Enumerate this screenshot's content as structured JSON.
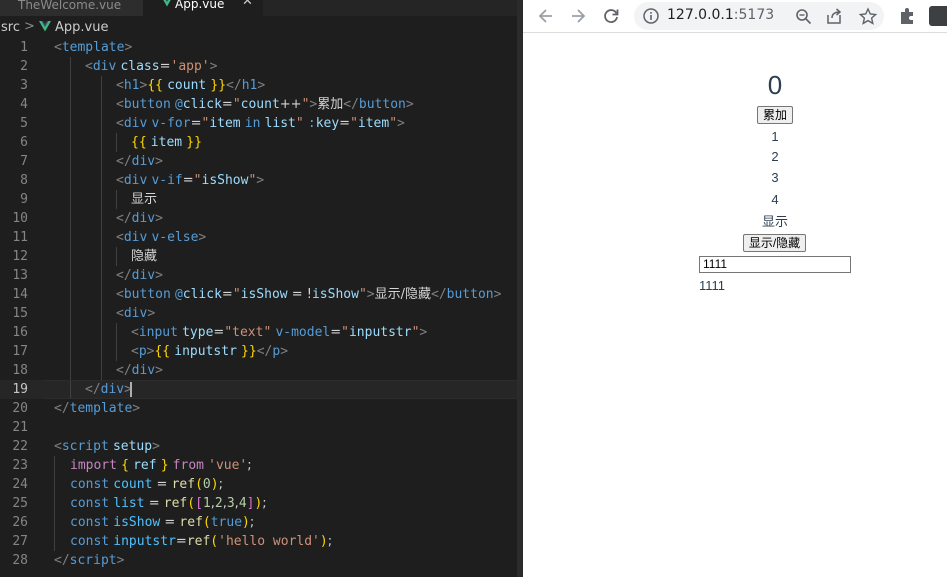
{
  "editor": {
    "tabs": [
      {
        "label": "TheWelcome.vue"
      },
      {
        "label": "App.vue",
        "close": "✕"
      }
    ],
    "breadcrumb": {
      "folder": "src",
      "separator": ">",
      "file": "App.vue"
    },
    "line_numbers": [
      "1",
      "2",
      "3",
      "4",
      "5",
      "6",
      "7",
      "8",
      "9",
      "10",
      "11",
      "12",
      "13",
      "14",
      "15",
      "16",
      "17",
      "18",
      "19",
      "20",
      "21",
      "22",
      "23",
      "24",
      "25",
      "26",
      "27",
      "28"
    ],
    "active_line": 19,
    "lines": [
      [
        [
          "br",
          "<"
        ],
        [
          "tag",
          "template"
        ],
        [
          "br",
          ">"
        ]
      ],
      [
        [
          "br",
          "<"
        ],
        [
          "tag",
          "div"
        ],
        [
          "txt",
          " "
        ],
        [
          "attr",
          "class"
        ],
        [
          "txt",
          "="
        ],
        [
          "str",
          "'app'"
        ],
        [
          "br",
          ">"
        ]
      ],
      [
        [
          "br",
          "<"
        ],
        [
          "tag",
          "h1"
        ],
        [
          "br",
          ">"
        ],
        [
          "mus",
          "{{"
        ],
        [
          "txt",
          " "
        ],
        [
          "var",
          "count"
        ],
        [
          "txt",
          " "
        ],
        [
          "mus",
          "}}"
        ],
        [
          "br",
          "</"
        ],
        [
          "tag",
          "h1"
        ],
        [
          "br",
          ">"
        ]
      ],
      [
        [
          "br",
          "<"
        ],
        [
          "tag",
          "button"
        ],
        [
          "txt",
          " "
        ],
        [
          "dir",
          "@"
        ],
        [
          "attr",
          "click"
        ],
        [
          "txt",
          "="
        ],
        [
          "str",
          "\""
        ],
        [
          "var",
          "count"
        ],
        [
          "txt",
          "++"
        ],
        [
          "str",
          "\""
        ],
        [
          "br",
          ">"
        ],
        [
          "txt",
          "累加"
        ],
        [
          "br",
          "</"
        ],
        [
          "tag",
          "button"
        ],
        [
          "br",
          ">"
        ]
      ],
      [
        [
          "br",
          "<"
        ],
        [
          "tag",
          "div"
        ],
        [
          "txt",
          " "
        ],
        [
          "dir",
          "v-for"
        ],
        [
          "txt",
          "="
        ],
        [
          "str",
          "\""
        ],
        [
          "var",
          "item"
        ],
        [
          "txt",
          " "
        ],
        [
          "decl",
          "in"
        ],
        [
          "txt",
          " "
        ],
        [
          "var",
          "list"
        ],
        [
          "str",
          "\""
        ],
        [
          "txt",
          " "
        ],
        [
          "dir",
          ":"
        ],
        [
          "attr",
          "key"
        ],
        [
          "txt",
          "="
        ],
        [
          "str",
          "\""
        ],
        [
          "var",
          "item"
        ],
        [
          "str",
          "\""
        ],
        [
          "br",
          ">"
        ]
      ],
      [
        [
          "mus",
          "{{"
        ],
        [
          "txt",
          " "
        ],
        [
          "var",
          "item"
        ],
        [
          "txt",
          " "
        ],
        [
          "mus",
          "}}"
        ]
      ],
      [
        [
          "br",
          "</"
        ],
        [
          "tag",
          "div"
        ],
        [
          "br",
          ">"
        ]
      ],
      [
        [
          "br",
          "<"
        ],
        [
          "tag",
          "div"
        ],
        [
          "txt",
          " "
        ],
        [
          "dir",
          "v-if"
        ],
        [
          "txt",
          "="
        ],
        [
          "str",
          "\""
        ],
        [
          "var",
          "isShow"
        ],
        [
          "str",
          "\""
        ],
        [
          "br",
          ">"
        ]
      ],
      [
        [
          "txt",
          "显示"
        ]
      ],
      [
        [
          "br",
          "</"
        ],
        [
          "tag",
          "div"
        ],
        [
          "br",
          ">"
        ]
      ],
      [
        [
          "br",
          "<"
        ],
        [
          "tag",
          "div"
        ],
        [
          "txt",
          " "
        ],
        [
          "dir",
          "v-else"
        ],
        [
          "br",
          ">"
        ]
      ],
      [
        [
          "txt",
          "隐藏"
        ]
      ],
      [
        [
          "br",
          "</"
        ],
        [
          "tag",
          "div"
        ],
        [
          "br",
          ">"
        ]
      ],
      [
        [
          "br",
          "<"
        ],
        [
          "tag",
          "button"
        ],
        [
          "txt",
          " "
        ],
        [
          "dir",
          "@"
        ],
        [
          "attr",
          "click"
        ],
        [
          "txt",
          "="
        ],
        [
          "str",
          "\""
        ],
        [
          "var",
          "isShow"
        ],
        [
          "txt",
          " = !"
        ],
        [
          "var",
          "isShow"
        ],
        [
          "str",
          "\""
        ],
        [
          "br",
          ">"
        ],
        [
          "txt",
          "显示/隐藏"
        ],
        [
          "br",
          "</"
        ],
        [
          "tag",
          "button"
        ],
        [
          "br",
          ">"
        ]
      ],
      [
        [
          "br",
          "<"
        ],
        [
          "tag",
          "div"
        ],
        [
          "br",
          ">"
        ]
      ],
      [
        [
          "br",
          "<"
        ],
        [
          "tag",
          "input"
        ],
        [
          "txt",
          " "
        ],
        [
          "attr",
          "type"
        ],
        [
          "txt",
          "="
        ],
        [
          "str",
          "\"text\""
        ],
        [
          "txt",
          " "
        ],
        [
          "dir",
          "v-model"
        ],
        [
          "txt",
          "="
        ],
        [
          "str",
          "\""
        ],
        [
          "var",
          "inputstr"
        ],
        [
          "str",
          "\""
        ],
        [
          "br",
          ">"
        ]
      ],
      [
        [
          "br",
          "<"
        ],
        [
          "tag",
          "p"
        ],
        [
          "br",
          ">"
        ],
        [
          "mus",
          "{{"
        ],
        [
          "txt",
          " "
        ],
        [
          "var",
          "inputstr"
        ],
        [
          "txt",
          " "
        ],
        [
          "mus",
          "}}"
        ],
        [
          "br",
          "</"
        ],
        [
          "tag",
          "p"
        ],
        [
          "br",
          ">"
        ]
      ],
      [
        [
          "br",
          "</"
        ],
        [
          "tag",
          "div"
        ],
        [
          "br",
          ">"
        ]
      ],
      [
        [
          "br",
          "</"
        ],
        [
          "tag",
          "div"
        ],
        [
          "br",
          ">"
        ]
      ],
      [
        [
          "br",
          "</"
        ],
        [
          "tag",
          "template"
        ],
        [
          "br",
          ">"
        ]
      ],
      [],
      [
        [
          "br",
          "<"
        ],
        [
          "tag",
          "script"
        ],
        [
          "txt",
          " "
        ],
        [
          "attr",
          "setup"
        ],
        [
          "br",
          ">"
        ]
      ],
      [
        [
          "kw",
          "import"
        ],
        [
          "txt",
          " "
        ],
        [
          "mus",
          "{"
        ],
        [
          "txt",
          " "
        ],
        [
          "var",
          "ref"
        ],
        [
          "txt",
          " "
        ],
        [
          "mus",
          "}"
        ],
        [
          "txt",
          " "
        ],
        [
          "kw",
          "from"
        ],
        [
          "txt",
          " "
        ],
        [
          "str",
          "'vue'"
        ],
        [
          "txt",
          ";"
        ]
      ],
      [
        [
          "decl",
          "const"
        ],
        [
          "txt",
          " "
        ],
        [
          "cst",
          "count"
        ],
        [
          "txt",
          " = "
        ],
        [
          "fn",
          "ref"
        ],
        [
          "mus",
          "("
        ],
        [
          "num",
          "0"
        ],
        [
          "mus",
          ")"
        ],
        [
          "txt",
          ";"
        ]
      ],
      [
        [
          "decl",
          "const"
        ],
        [
          "txt",
          " "
        ],
        [
          "cst",
          "list"
        ],
        [
          "txt",
          " = "
        ],
        [
          "fn",
          "ref"
        ],
        [
          "mus",
          "("
        ],
        [
          "bk2",
          "["
        ],
        [
          "num",
          "1"
        ],
        [
          "txt",
          ","
        ],
        [
          "num",
          "2"
        ],
        [
          "txt",
          ","
        ],
        [
          "num",
          "3"
        ],
        [
          "txt",
          ","
        ],
        [
          "num",
          "4"
        ],
        [
          "bk2",
          "]"
        ],
        [
          "mus",
          ")"
        ],
        [
          "txt",
          ";"
        ]
      ],
      [
        [
          "decl",
          "const"
        ],
        [
          "txt",
          " "
        ],
        [
          "cst",
          "isShow"
        ],
        [
          "txt",
          " = "
        ],
        [
          "fn",
          "ref"
        ],
        [
          "mus",
          "("
        ],
        [
          "decl",
          "true"
        ],
        [
          "mus",
          ")"
        ],
        [
          "txt",
          ";"
        ]
      ],
      [
        [
          "decl",
          "const"
        ],
        [
          "txt",
          " "
        ],
        [
          "cst",
          "inputstr"
        ],
        [
          "txt",
          "="
        ],
        [
          "fn",
          "ref"
        ],
        [
          "mus",
          "("
        ],
        [
          "str",
          "'hello world'"
        ],
        [
          "mus",
          ")"
        ],
        [
          "txt",
          ";"
        ]
      ],
      [
        [
          "br",
          "</"
        ],
        [
          "tag",
          "script"
        ],
        [
          "br",
          ">"
        ]
      ]
    ]
  },
  "browser": {
    "url_host": "127.0.0.1",
    "url_port": ":5173",
    "page": {
      "count": "0",
      "increment_button": "累加",
      "list_items": [
        "1",
        "2",
        "3",
        "4"
      ],
      "show_text": "显示",
      "toggle_button": "显示/隐藏",
      "input_value": "1111",
      "output_text": "1111"
    }
  }
}
